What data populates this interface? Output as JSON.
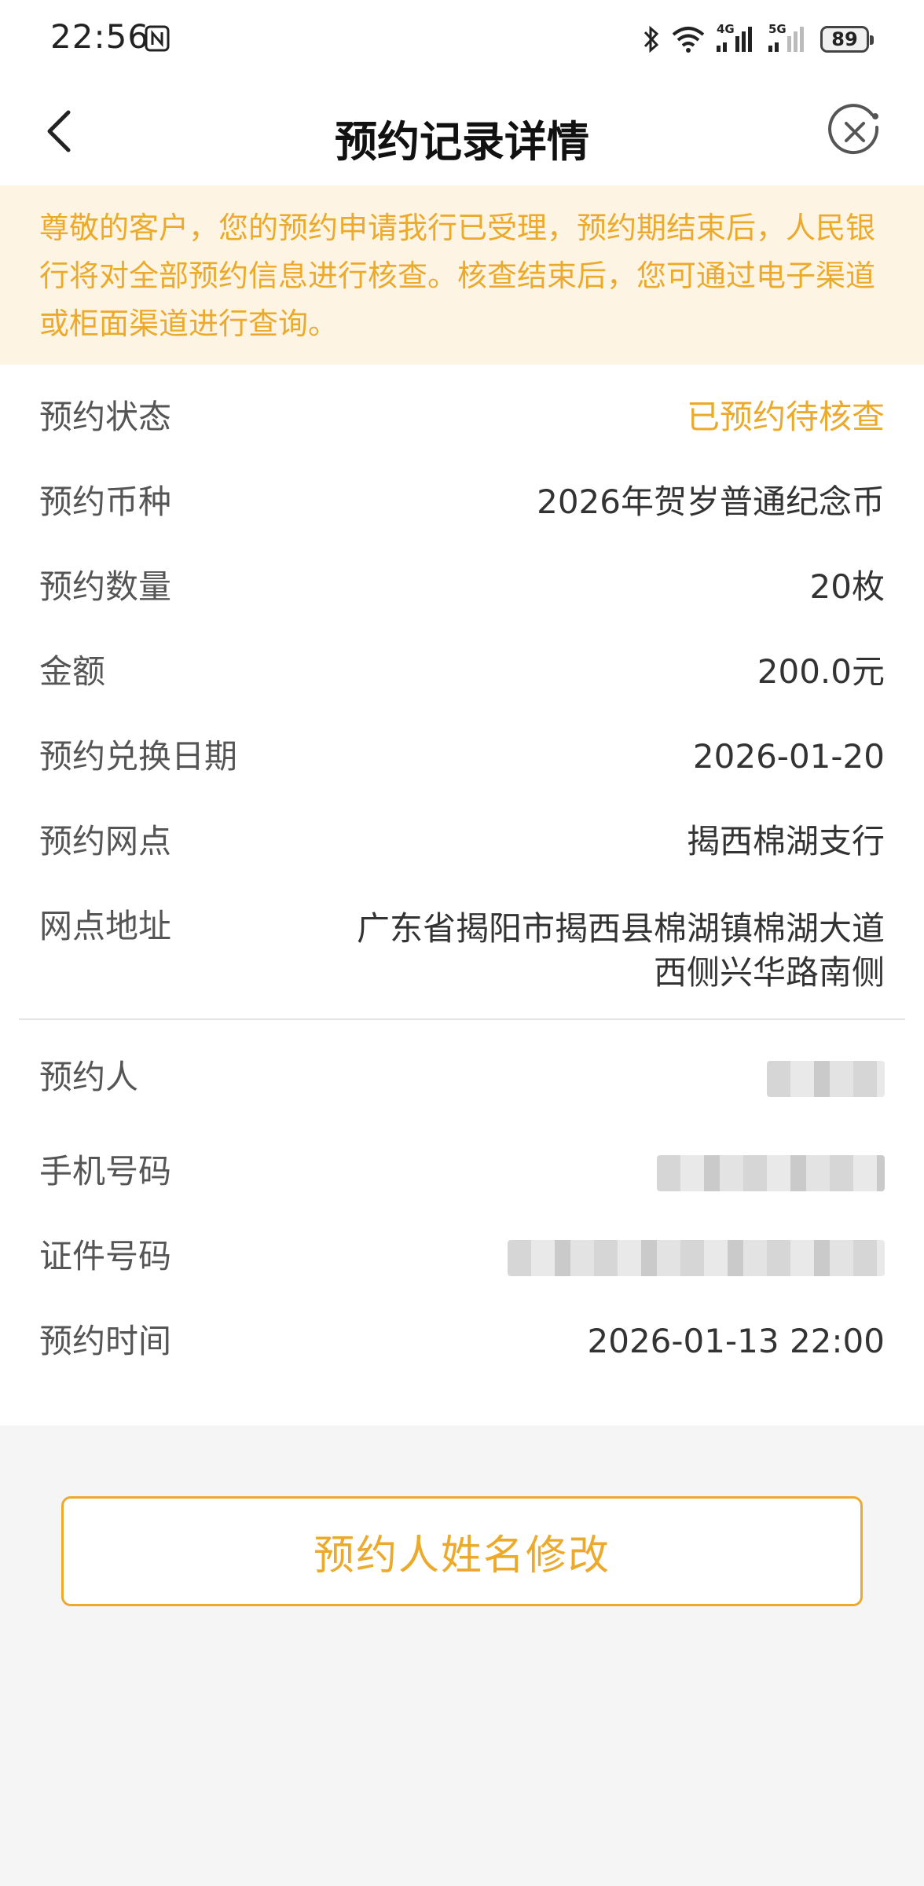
{
  "status_bar": {
    "time": "22:56",
    "sig1_label": "4G",
    "sig2_label": "5G",
    "battery": "89"
  },
  "nav": {
    "title": "预约记录详情"
  },
  "notice": {
    "text": "尊敬的客户，您的预约申请我行已受理，预约期结束后，人民银行将对全部预约信息进行核查。核查结束后，您可通过电子渠道或柜面渠道进行查询。"
  },
  "details": {
    "rows": [
      {
        "label": "预约状态",
        "value": "已预约待核查"
      },
      {
        "label": "预约币种",
        "value": "2026年贺岁普通纪念币"
      },
      {
        "label": "预约数量",
        "value": "20枚"
      },
      {
        "label": "金额",
        "value": "200.0元"
      },
      {
        "label": "预约兑换日期",
        "value": "2026-01-20"
      },
      {
        "label": "预约网点",
        "value": "揭西棉湖支行"
      },
      {
        "label": "网点地址",
        "value": "广东省揭阳市揭西县棉湖镇棉湖大道西侧兴华路南侧"
      }
    ],
    "personal": [
      {
        "label": "预约人"
      },
      {
        "label": "手机号码"
      },
      {
        "label": "证件号码"
      },
      {
        "label": "预约时间",
        "value": "2026-01-13 22:00"
      }
    ]
  },
  "action": {
    "edit_button": "预约人姓名修改"
  },
  "colors": {
    "accent": "#ecaa2c",
    "notice_bg": "#fdf4e4"
  },
  "icons": {
    "back": "chevron-left-icon",
    "close": "close-circle-icon",
    "nfc": "nfc-icon",
    "bluetooth": "bluetooth-icon",
    "wifi": "wifi-icon"
  }
}
